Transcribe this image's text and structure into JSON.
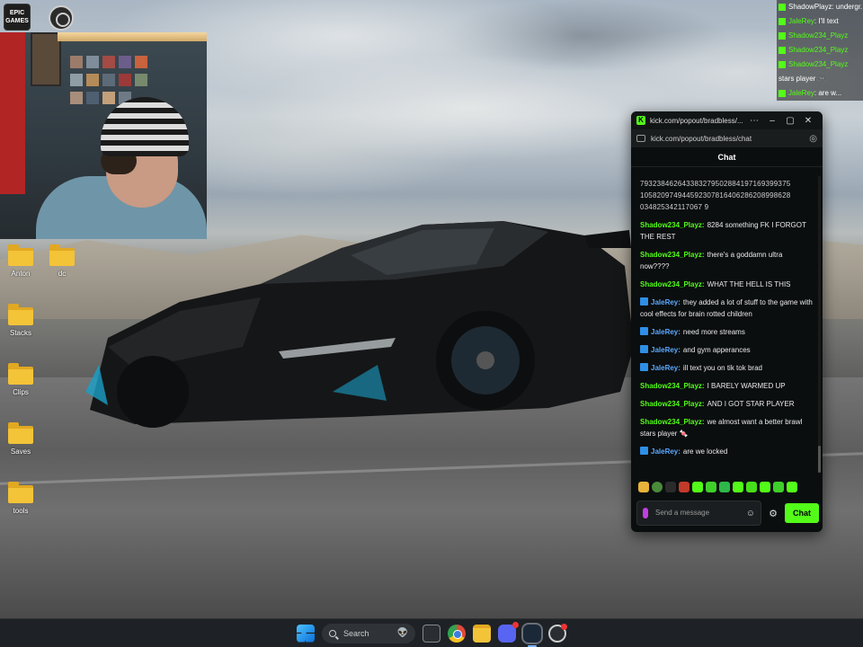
{
  "desktop": {
    "top_icons": [
      {
        "name": "epic-games-icon",
        "label": "EPIC GAMES"
      },
      {
        "name": "obs-icon",
        "label": ""
      }
    ],
    "folders": [
      {
        "label": "Anton"
      },
      {
        "label": "dc"
      },
      {
        "label": "Stacks"
      },
      {
        "label": "Clips"
      },
      {
        "label": "Saves"
      },
      {
        "label": "tools"
      }
    ]
  },
  "overlay": {
    "rows": [
      {
        "user": "",
        "text": "ShadowPlayz: undergr..."
      },
      {
        "user": "JaleRey",
        "text": ": I'll text"
      },
      {
        "user": "Shadow234_Playz",
        "text": ""
      },
      {
        "user": "Shadow234_Playz",
        "text": ""
      },
      {
        "user": "Shadow234_Playz",
        "text": ""
      },
      {
        "user": "",
        "text": "stars player 🎮"
      },
      {
        "user": "JaleRey",
        "text": ": are w..."
      }
    ]
  },
  "chat_window": {
    "title": "kick.com/popout/bradbless/...",
    "url": "kick.com/popout/bradbless/chat",
    "header": "Chat",
    "messages": [
      {
        "user": "",
        "text": "793238462643383279502884197169399375 105820974944592307816406286208998628 034825342117067 9",
        "kind": "num"
      },
      {
        "user": "Shadow234_Playz:",
        "text": "8284 something FK I FORGOT THE REST",
        "kind": "shadow"
      },
      {
        "user": "Shadow234_Playz:",
        "text": "there's a goddamn ultra now????",
        "kind": "shadow"
      },
      {
        "user": "Shadow234_Playz:",
        "text": "WHAT THE HELL IS THIS",
        "kind": "shadow"
      },
      {
        "user": "JaleRey:",
        "text": "they added a lot of stuff to the game with cool effects for brain rotted children",
        "kind": "jale"
      },
      {
        "user": "JaleRey:",
        "text": "need more streams",
        "kind": "jale"
      },
      {
        "user": "JaleRey:",
        "text": "and gym apperances",
        "kind": "jale"
      },
      {
        "user": "JaleRey:",
        "text": "ill text you on tik tok brad",
        "kind": "jale"
      },
      {
        "user": "Shadow234_Playz:",
        "text": "I BARELY WARMED UP",
        "kind": "shadow"
      },
      {
        "user": "Shadow234_Playz:",
        "text": "AND I GOT STAR PLAYER",
        "kind": "shadow"
      },
      {
        "user": "Shadow234_Playz:",
        "text": "we almost want a better brawl stars player 🍬",
        "kind": "shadow"
      },
      {
        "user": "JaleRey:",
        "text": "are we locked",
        "kind": "jale"
      }
    ],
    "input_placeholder": "Send a message",
    "chat_button": "Chat"
  },
  "taskbar": {
    "search_label": "Search"
  },
  "colors": {
    "kick_green": "#53fc18",
    "jale_blue": "#5aa9ff"
  }
}
